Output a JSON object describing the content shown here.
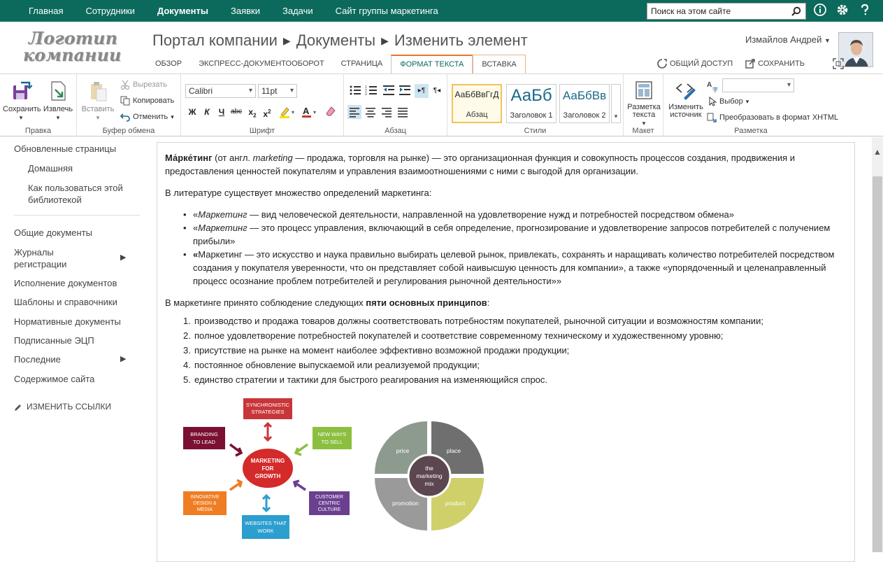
{
  "topnav": {
    "items": [
      "Главная",
      "Сотрудники",
      "Документы",
      "Заявки",
      "Задачи",
      "Сайт группы маркетинга"
    ],
    "active_index": 2,
    "search_placeholder": "Поиск на этом сайте"
  },
  "header": {
    "logo_line1": "Логотип",
    "logo_line2": "компании",
    "breadcrumb": [
      "Портал компании",
      "Документы",
      "Изменить элемент"
    ],
    "user_name": "Измайлов Андрей",
    "share_label": "ОБЩИЙ ДОСТУП",
    "save_label": "СОХРАНИТЬ"
  },
  "tabs": [
    "ОБЗОР",
    "ЭКСПРЕСС-ДОКУМЕНТООБОРОТ",
    "СТРАНИЦА",
    "ФОРМАТ ТЕКСТА",
    "ВСТАВКА"
  ],
  "ribbon": {
    "edit": {
      "label": "Правка",
      "save": "Сохранить",
      "checkout": "Извлечь"
    },
    "clipboard": {
      "label": "Буфер обмена",
      "paste": "Вставить",
      "cut": "Вырезать",
      "copy": "Копировать",
      "undo": "Отменить"
    },
    "font": {
      "label": "Шрифт",
      "family": "Calibri",
      "size": "11pt"
    },
    "paragraph": {
      "label": "Абзац"
    },
    "styles": {
      "label": "Стили",
      "items": [
        {
          "sample": "АаБбВвГгД",
          "name": "Абзац"
        },
        {
          "sample": "АаБб",
          "name": "Заголовок 1"
        },
        {
          "sample": "АаБбВв",
          "name": "Заголовок 2"
        }
      ]
    },
    "layout": {
      "label": "Макет",
      "text_layout": "Разметка текста"
    },
    "markup": {
      "label": "Разметка",
      "edit_source": "Изменить источник",
      "select": "Выбор",
      "convert": "Преобразовать в формат XHTML"
    }
  },
  "leftnav": {
    "updated": "Обновленные страницы",
    "home": "Домашняя",
    "howto": "Как пользоваться этой библиотекой",
    "items": [
      "Общие документы",
      "Журналы регистрации",
      "Исполнение документов",
      "Шаблоны и справочники",
      "Нормативные документы",
      "Подписанные ЭЦП",
      "Последние",
      "Содержимое сайта"
    ],
    "edit_links": "ИЗМЕНИТЬ ССЫЛКИ"
  },
  "content": {
    "p1_term": "Ма́рке́тинг",
    "p1_a": " (от англ. ",
    "p1_marketing": "marketing",
    "p1_b": " — продажа, торговля на рынке) — это организационная функция и совокупность процессов создания, продвижения и предоставления ценностей покупателям и управления взаимоотношениями с ними с выгодой для организации.",
    "p2": "В литературе существует множество определений маркетинга:",
    "def1_open": "«",
    "def1_term": "Маркетинг",
    "def1_rest": " — вид человеческой деятельности, направленной на удовлетворение нужд и потребностей посредством обмена»",
    "def2_open": "«",
    "def2_term": "Маркетинг",
    "def2_rest": " — это процесс управления, включающий в себя определение, прогнозирование и удовлетворение запросов потребителей с получением прибыли»",
    "def3_open": "«",
    "def3_rest": "Маркетинг — это искусство и наука правильно выбирать целевой рынок, привлекать, сохранять и наращивать количество потребителей посредством создания у покупателя уверенности, что он представляет собой наивысшую ценность для компании», а также «упорядоченный и целенаправленный процесс осознание проблем потребителей и регулирования рыночной деятельности»»",
    "p3_a": "В маркетинге принято соблюдение следующих ",
    "p3_bold": "пяти основных принципов",
    "p3_b": ":",
    "principles": [
      "производство и продажа товаров должны соответствовать потребностям покупателей, рыночной ситуации и возможностям компании;",
      "полное удовлетворение потребностей покупателей и соответствие современному техническому и художественному уровню;",
      "присутствие на рынке на момент наиболее эффективно возможной продажи продукции;",
      "постоянное обновление выпускаемой или реализуемой продукции;",
      "единство стратегии и тактики для быстрого реагирования на изменяющийся спрос."
    ]
  },
  "diagram_growth": {
    "center": [
      "MARKETING",
      "FOR",
      "GROWTH"
    ],
    "top": [
      "SYNCHRONISTIC",
      "STRATEGIES"
    ],
    "left": [
      "BRANDING",
      "TO LEAD"
    ],
    "right": [
      "NEW WAYS",
      "TO SELL"
    ],
    "bottom_left": [
      "INNOVATIVE",
      "DESIGN &",
      "MEDIA"
    ],
    "bottom_right": [
      "CUSTOMER",
      "CENTRIC",
      "CULTURE"
    ],
    "bottom": [
      "WEBSITES THAT",
      "WORK"
    ]
  },
  "diagram_mix": {
    "center": [
      "the",
      "marketing",
      "mix"
    ],
    "q1": "price",
    "q2": "place",
    "q3": "promotion",
    "q4": "product"
  }
}
